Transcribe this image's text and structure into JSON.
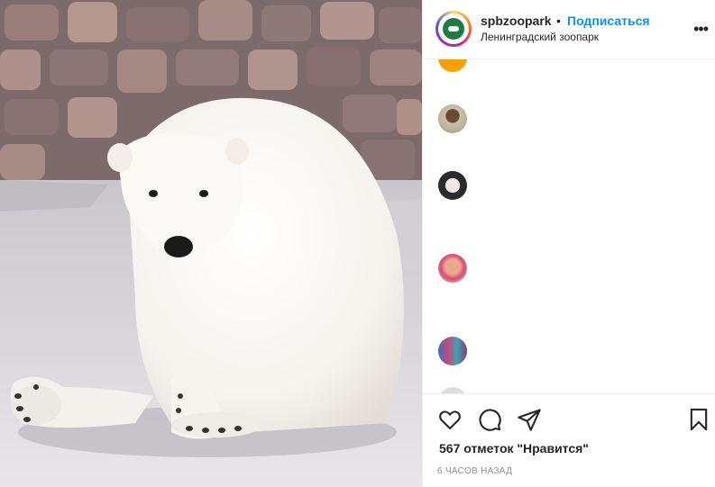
{
  "post": {
    "image_alt": "polar bear sitting",
    "header": {
      "username": "spbzoopark",
      "separator": "•",
      "follow_label": "Подписаться",
      "location": "Ленинградский зоопарк",
      "more_icon": "ellipsis-icon"
    },
    "comments": {
      "avatars": [
        "commenter-avatar-1",
        "commenter-avatar-2",
        "commenter-avatar-3",
        "commenter-avatar-4",
        "commenter-avatar-5",
        "commenter-avatar-6"
      ]
    },
    "actions": {
      "like_icon": "heart-icon",
      "comment_icon": "comment-icon",
      "share_icon": "send-icon",
      "save_icon": "bookmark-icon"
    },
    "likes_text": "567 отметок \"Нравится\"",
    "timestamp": "6 ЧАСОВ НАЗАД",
    "colors": {
      "link": "#0095f6",
      "text": "#262626",
      "muted": "#8e8e8e"
    }
  }
}
